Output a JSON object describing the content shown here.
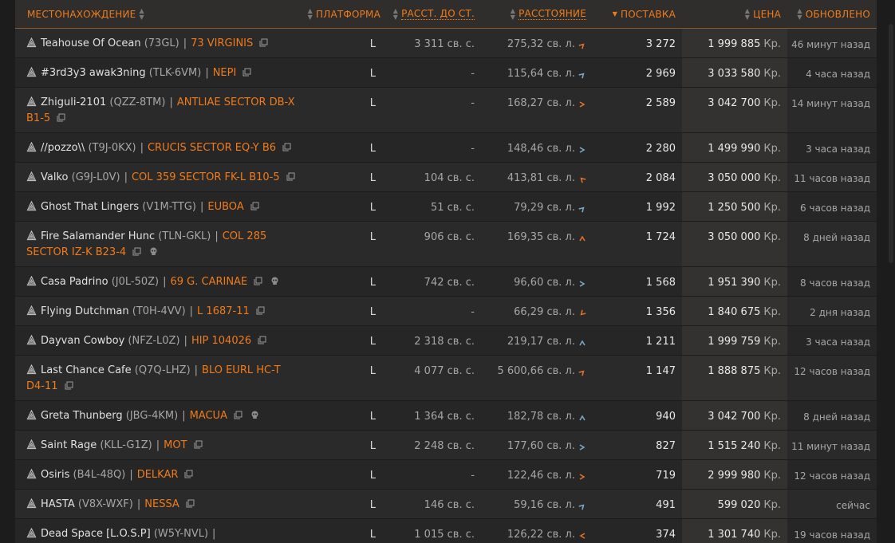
{
  "header": {
    "location": "Местонахождение",
    "platform": "Платформа",
    "dist_to_star": "Расст. до ст.",
    "distance": "Расстояние",
    "supply": "Поставка",
    "price": "Цена",
    "updated": "Обновлено"
  },
  "colors": {
    "accent": "#f07b1a",
    "arrow": "#e0702a",
    "arrow_blue": "#7aa7c7"
  },
  "units": {
    "ls": "св. с.",
    "ly": "св. л.",
    "credits": "Кр."
  },
  "rows": [
    {
      "station": "Teahouse Of Ocean",
      "code": "(73GL)",
      "system": "73 VIRGINIS",
      "platform": "L",
      "dist_star": "3 311",
      "distance": "275,32",
      "arrow": "up-right",
      "supply": "3 272",
      "price": "1 999 885",
      "updated": "46 минут назад",
      "skull": false,
      "tall": false
    },
    {
      "station": "#3rd3y3 awak3ning",
      "code": "(TLK-6VM)",
      "system": "NEPI",
      "platform": "L",
      "dist_star": "-",
      "distance": "115,64",
      "arrow": "up-right-blue",
      "supply": "2 969",
      "price": "3 033 580",
      "updated": "4 часа назад",
      "skull": false,
      "tall": false
    },
    {
      "station": "Zhiguli-2101",
      "code": "(QZZ-8TM)",
      "system": "ANTLIAE SECTOR DB-X B1-5",
      "platform": "L",
      "dist_star": "-",
      "distance": "168,27",
      "arrow": "right",
      "supply": "2 589",
      "price": "3 042 700",
      "updated": "14 минут назад",
      "skull": false,
      "tall": true
    },
    {
      "station": "//pozzo\\\\",
      "code": "(T9J-0KX)",
      "system": "CRUCIS SECTOR EQ-Y B6",
      "platform": "L",
      "dist_star": "-",
      "distance": "148,46",
      "arrow": "right-blue",
      "supply": "2 280",
      "price": "1 499 990",
      "updated": "3 часа назад",
      "skull": false,
      "tall": false
    },
    {
      "station": "Valko",
      "code": "(G9J-L0V)",
      "system": "COL 359 SECTOR FK-L B10-5",
      "platform": "L",
      "dist_star": "104",
      "distance": "413,81",
      "arrow": "up-left",
      "supply": "2 084",
      "price": "3 050 000",
      "updated": "11 часов назад",
      "skull": false,
      "tall": false
    },
    {
      "station": "Ghost That Lingers",
      "code": "(V1M-TTG)",
      "system": "EUBOA",
      "platform": "L",
      "dist_star": "51",
      "distance": "79,29",
      "arrow": "up-right-blue",
      "supply": "1 992",
      "price": "1 250 500",
      "updated": "6 часов назад",
      "skull": false,
      "tall": false
    },
    {
      "station": "Fire Salamander Hunc",
      "code": "(TLN-GKL)",
      "system": "COL 285 SECTOR IZ-K B23-4",
      "platform": "L",
      "dist_star": "906",
      "distance": "169,35",
      "arrow": "up",
      "supply": "1 724",
      "price": "3 050 000",
      "updated": "8 дней назад",
      "skull": true,
      "tall": true
    },
    {
      "station": "Casa Padrino",
      "code": "(J0L-50Z)",
      "system": "69 G. CARINAE",
      "platform": "L",
      "dist_star": "742",
      "distance": "96,60",
      "arrow": "right-blue",
      "supply": "1 568",
      "price": "1 951 390",
      "updated": "8 часов назад",
      "skull": true,
      "tall": false
    },
    {
      "station": "Flying Dutchman",
      "code": "(T0H-4VV)",
      "system": "L 1687-11",
      "platform": "L",
      "dist_star": "-",
      "distance": "66,29",
      "arrow": "down-left",
      "supply": "1 356",
      "price": "1 840 675",
      "updated": "2 дня назад",
      "skull": false,
      "tall": false
    },
    {
      "station": "Dayvan Cowboy",
      "code": "(NFZ-L0Z)",
      "system": "HIP 104026",
      "platform": "L",
      "dist_star": "2 318",
      "distance": "219,17",
      "arrow": "up-blue",
      "supply": "1 211",
      "price": "1 999 759",
      "updated": "3 часа назад",
      "skull": false,
      "tall": false
    },
    {
      "station": "Last Chance Cafe",
      "code": "(Q7Q-LHZ)",
      "system": "BLO EURL HC-T D4-11",
      "platform": "L",
      "dist_star": "4 077",
      "distance": "5 600,66",
      "arrow": "up-right",
      "supply": "1 147",
      "price": "1 888 875",
      "updated": "12 часов назад",
      "skull": false,
      "tall": true
    },
    {
      "station": "Greta Thunberg",
      "code": "(JBG-4KM)",
      "system": "MACUA",
      "platform": "L",
      "dist_star": "1 364",
      "distance": "182,78",
      "arrow": "up-blue",
      "supply": "940",
      "price": "3 042 700",
      "updated": "8 дней назад",
      "skull": true,
      "tall": false
    },
    {
      "station": "Saint Rage",
      "code": "(KLL-G1Z)",
      "system": "MOT",
      "platform": "L",
      "dist_star": "2 248",
      "distance": "177,60",
      "arrow": "right-blue",
      "supply": "827",
      "price": "1 515 240",
      "updated": "11 минут назад",
      "skull": false,
      "tall": false
    },
    {
      "station": "Osiris",
      "code": "(B4L-48Q)",
      "system": "DELKAR",
      "platform": "L",
      "dist_star": "-",
      "distance": "122,46",
      "arrow": "right",
      "supply": "719",
      "price": "2 999 980",
      "updated": "12 часов назад",
      "skull": false,
      "tall": false
    },
    {
      "station": "HASTA",
      "code": "(V8X-WXF)",
      "system": "NESSA",
      "platform": "L",
      "dist_star": "146",
      "distance": "59,16",
      "arrow": "up-right-blue",
      "supply": "491",
      "price": "599 020",
      "updated": "сейчас",
      "skull": false,
      "tall": false
    },
    {
      "station": "Dead Space [L.O.S.P]",
      "code": "(W5Y-NVL)",
      "system": "",
      "platform": "L",
      "dist_star": "1 015",
      "distance": "126,22",
      "arrow": "left",
      "supply": "374",
      "price": "1 301 740",
      "updated": "19 часов назад",
      "skull": false,
      "tall": true
    }
  ]
}
